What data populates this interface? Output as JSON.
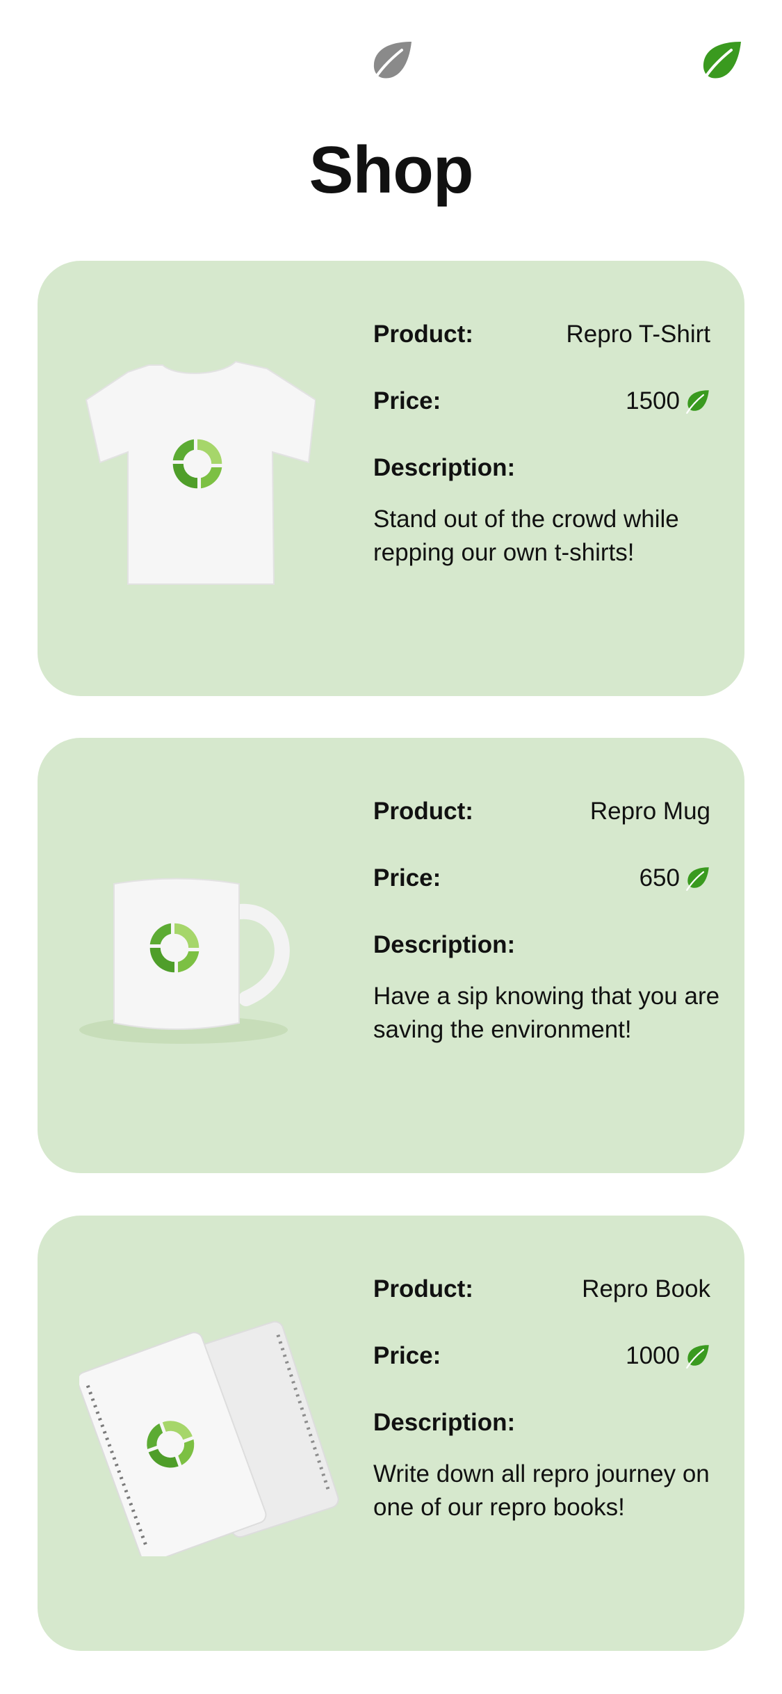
{
  "header": {
    "title": "Shop",
    "left_icon": "leaf-icon",
    "right_icon": "leaf-icon",
    "left_icon_color": "#8a8a8a",
    "right_icon_color": "#3a9a1f"
  },
  "labels": {
    "product": "Product:",
    "price": "Price:",
    "description": "Description:"
  },
  "products": [
    {
      "image": "tshirt-image",
      "name": "Repro T-Shirt",
      "price": "1500",
      "currency_icon": "leaf-icon",
      "description": "Stand out of the crowd while repping our own t-shirts!"
    },
    {
      "image": "mug-image",
      "name": "Repro Mug",
      "price": "650",
      "currency_icon": "leaf-icon",
      "description": "Have a sip knowing that you are saving the environment!"
    },
    {
      "image": "notebook-image",
      "name": "Repro Book",
      "price": "1000",
      "currency_icon": "leaf-icon",
      "description": "Write down all repro journey on one of our repro books!"
    }
  ],
  "colors": {
    "card_bg": "#d6e8cd",
    "accent_green": "#3a9a1f",
    "light_green": "#a6d66a"
  }
}
